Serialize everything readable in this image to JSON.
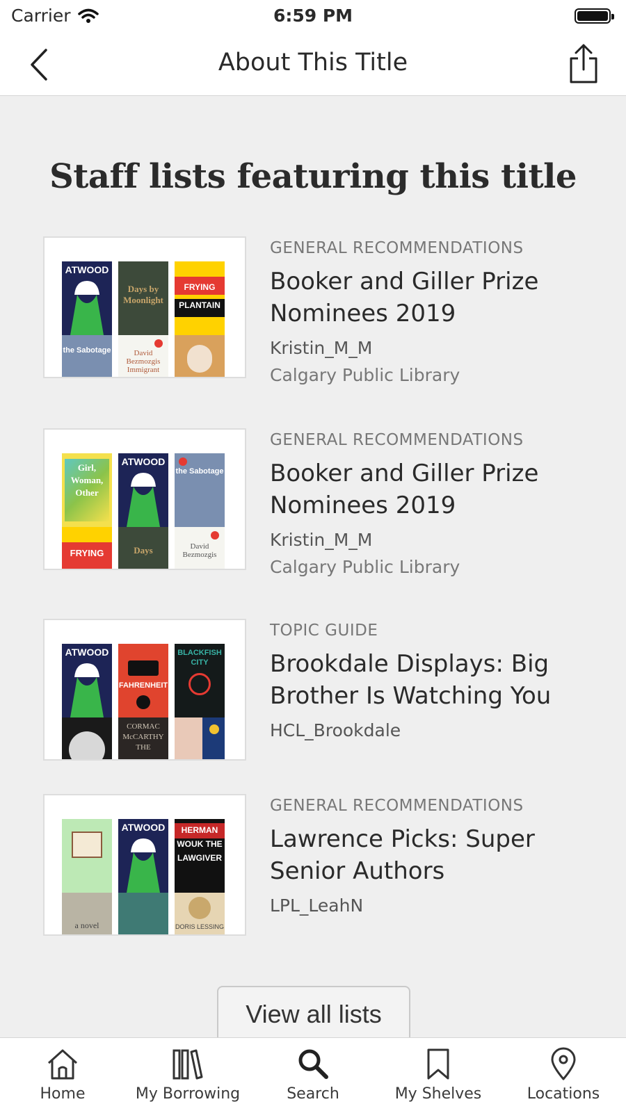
{
  "status_bar": {
    "carrier": "Carrier",
    "time": "6:59 PM"
  },
  "nav": {
    "title": "About This Title",
    "back_icon": "chevron-left-icon",
    "share_icon": "share-icon"
  },
  "section": {
    "title": "Staff lists featuring this title"
  },
  "lists": [
    {
      "category": "GENERAL RECOMMENDATIONS",
      "name": "Booker and Giller Prize Nominees 2019",
      "author": "Kristin_M_M",
      "library": "Calgary Public Library",
      "covers": [
        "ATWOOD",
        "Days by Moonlight",
        "FRYING PLANTAIN",
        "the Sabotage",
        "David Bezmozgis Immigrant",
        ""
      ]
    },
    {
      "category": "GENERAL RECOMMENDATIONS",
      "name": "Booker and Giller Prize Nominees 2019",
      "author": "Kristin_M_M",
      "library": "Calgary Public Library",
      "covers": [
        "Girl, Woman, Other",
        "ATWOOD",
        "the Sabotage",
        "FRYING",
        "Days",
        "David Bezmozgis"
      ]
    },
    {
      "category": "TOPIC GUIDE",
      "name": "Brookdale Displays: Big Brother Is Watching You",
      "author": "HCL_Brookdale",
      "library": "",
      "covers": [
        "ATWOOD",
        "FAHRENHEIT",
        "BLACKFISH CITY",
        "",
        "CORMAC McCARTHY THE",
        ""
      ]
    },
    {
      "category": "GENERAL RECOMMENDATIONS",
      "name": "Lawrence Picks: Super Senior Authors",
      "author": "LPL_LeahN",
      "library": "",
      "covers": [
        "",
        "ATWOOD",
        "HERMAN WOUK THE LAWGIVER",
        "a novel",
        "",
        "DORIS LESSING"
      ]
    }
  ],
  "view_all_label": "View all lists",
  "tabs": [
    {
      "label": "Home",
      "icon": "home-icon"
    },
    {
      "label": "My Borrowing",
      "icon": "books-icon"
    },
    {
      "label": "Search",
      "icon": "search-icon"
    },
    {
      "label": "My Shelves",
      "icon": "bookmark-icon"
    },
    {
      "label": "Locations",
      "icon": "location-pin-icon"
    }
  ],
  "colors": {
    "background": "#efefef",
    "navy_cover": "#1d2456",
    "green_figure": "#39b54a"
  }
}
